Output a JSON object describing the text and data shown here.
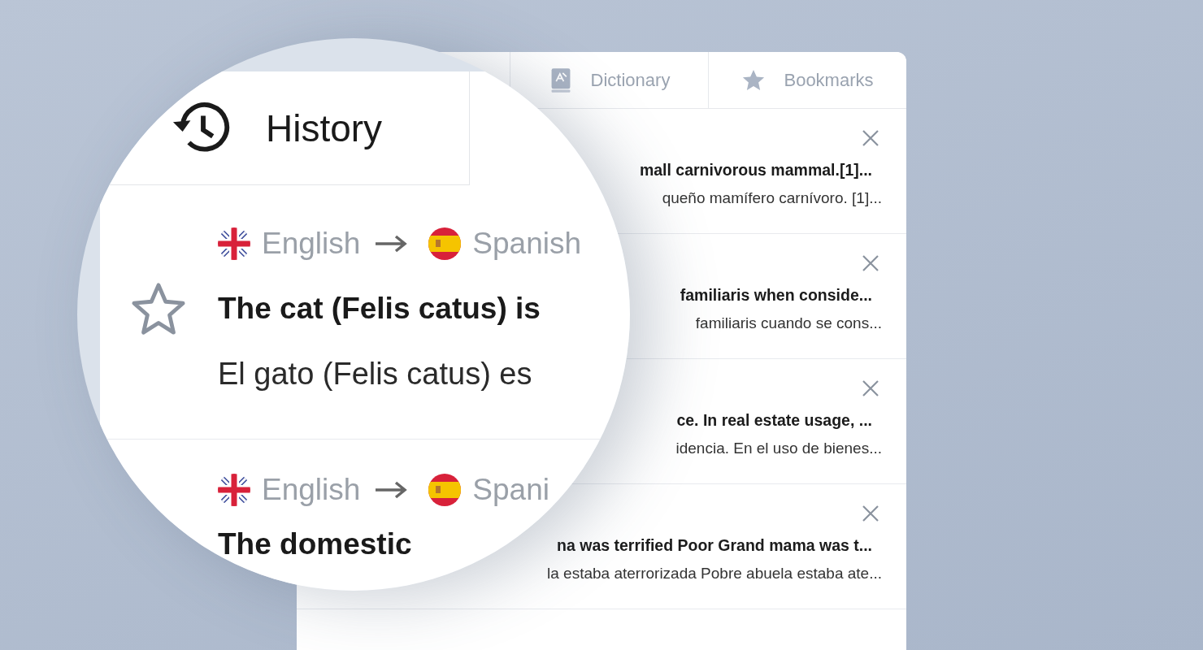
{
  "panel": {
    "tabs": [
      {
        "label": "Dictionary",
        "selected": false,
        "kind": "book"
      },
      {
        "label": "Bookmarks",
        "selected": false,
        "kind": "star"
      }
    ],
    "entries": [
      {
        "source": "mall carnivorous mammal.[1]...",
        "translation": "queño mamífero carnívoro. [1]..."
      },
      {
        "source": "familiaris when conside...",
        "translation": "familiaris cuando se cons..."
      },
      {
        "source": "ce. In real estate usage, ...",
        "translation": "idencia. En el uso de bienes..."
      },
      {
        "source": "na was terrified Poor Grand mama was t...",
        "translation": "la estaba aterrorizada Pobre abuela estaba ate..."
      }
    ]
  },
  "magnifier": {
    "tab": {
      "label": "History",
      "selected": true
    },
    "entries": [
      {
        "from": "English",
        "to": "Spanish",
        "bookmarked": false,
        "source": "The cat (Felis catus) is",
        "translation": "El gato (Felis catus) es"
      },
      {
        "from": "English",
        "to": "Spani",
        "source": "The domestic"
      }
    ]
  }
}
